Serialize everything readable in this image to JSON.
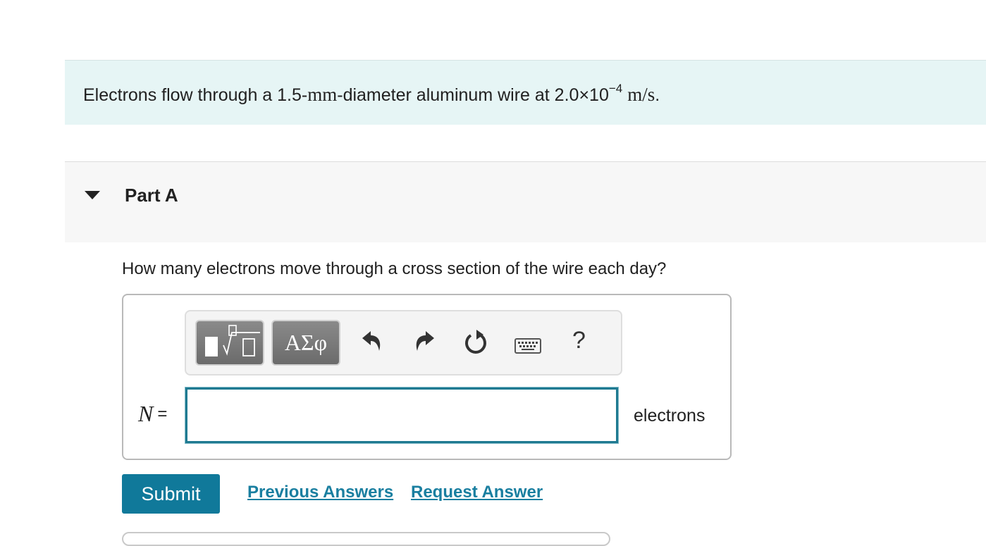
{
  "intro": {
    "text_before": "Electrons flow through a 1.5-",
    "unit_mm": "mm",
    "text_middle": "-diameter aluminum wire at 2.0×10",
    "exponent": "−4",
    "unit_speed": "m/s",
    "period": "."
  },
  "part": {
    "title": "Part A",
    "question": "How many electrons move through a cross section of the wire each day?"
  },
  "toolbar": {
    "symbols_label": "ΑΣφ",
    "help_label": "?",
    "icons": [
      "templates-icon",
      "greek-symbols-icon",
      "undo-icon",
      "redo-icon",
      "reset-icon",
      "keyboard-icon",
      "help-icon"
    ]
  },
  "answer": {
    "variable": "N",
    "equals": "=",
    "value": "",
    "units": "electrons"
  },
  "actions": {
    "submit_label": "Submit",
    "previous_answers_label": "Previous Answers",
    "request_answer_label": "Request Answer"
  },
  "colors": {
    "intro_bg": "#e6f5f5",
    "accent": "#10799a",
    "link": "#1a7fa0"
  }
}
